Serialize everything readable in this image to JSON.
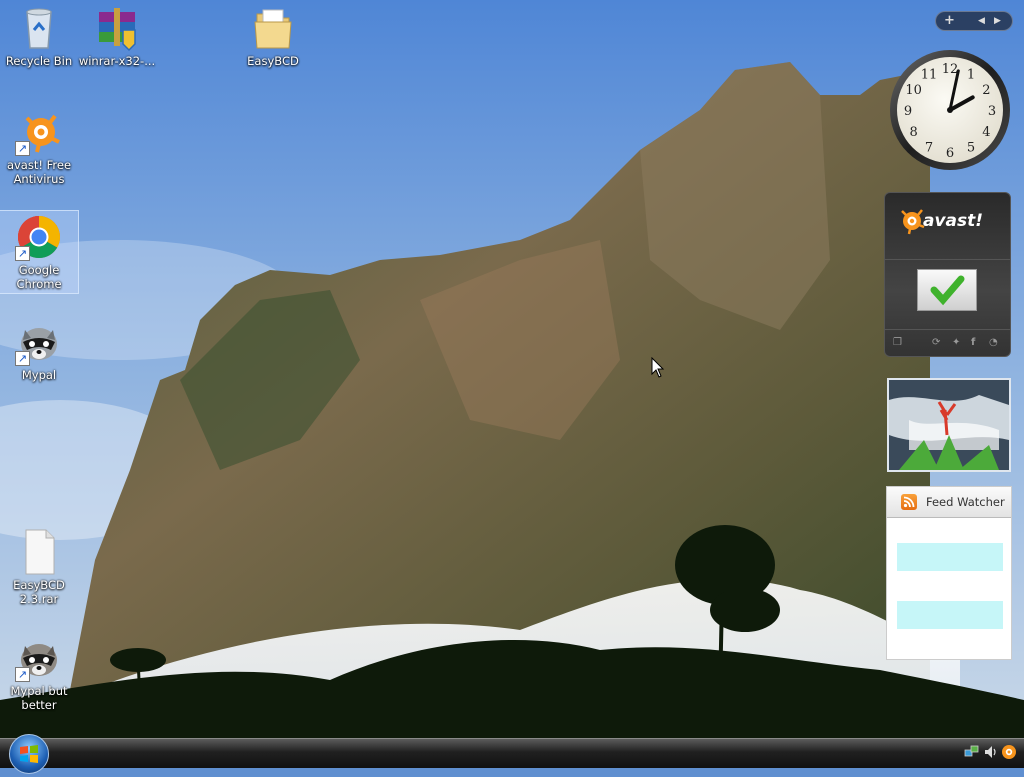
{
  "desktop": {
    "icons": [
      {
        "label": "Recycle Bin"
      },
      {
        "label": "winrar-x32-..."
      },
      {
        "label": "EasyBCD"
      },
      {
        "label": "avast! Free Antivirus"
      },
      {
        "label": "Google Chrome"
      },
      {
        "label": "Mypal"
      },
      {
        "label": "EasyBCD 2.3.rar"
      },
      {
        "label": "Mypal but better"
      }
    ]
  },
  "sidebar": {
    "top_controls": [
      "plus-icon",
      "left-arrow-icon",
      "right-arrow-icon"
    ],
    "clock": {
      "hour": 2,
      "minute": 2
    },
    "avast": {
      "logo_text": "avast!",
      "status_icon": "checkmark-icon"
    },
    "feed_watcher": {
      "title": "Feed Watcher"
    }
  },
  "taskbar": {
    "tray_icons": [
      "network-icon",
      "volume-icon",
      "avast-tray-icon"
    ]
  },
  "colors": {
    "sky": "#5f8fd0",
    "avast_orange": "#f7941d",
    "check_green": "#3fb22c",
    "feed_row": "#c6f6f8"
  }
}
